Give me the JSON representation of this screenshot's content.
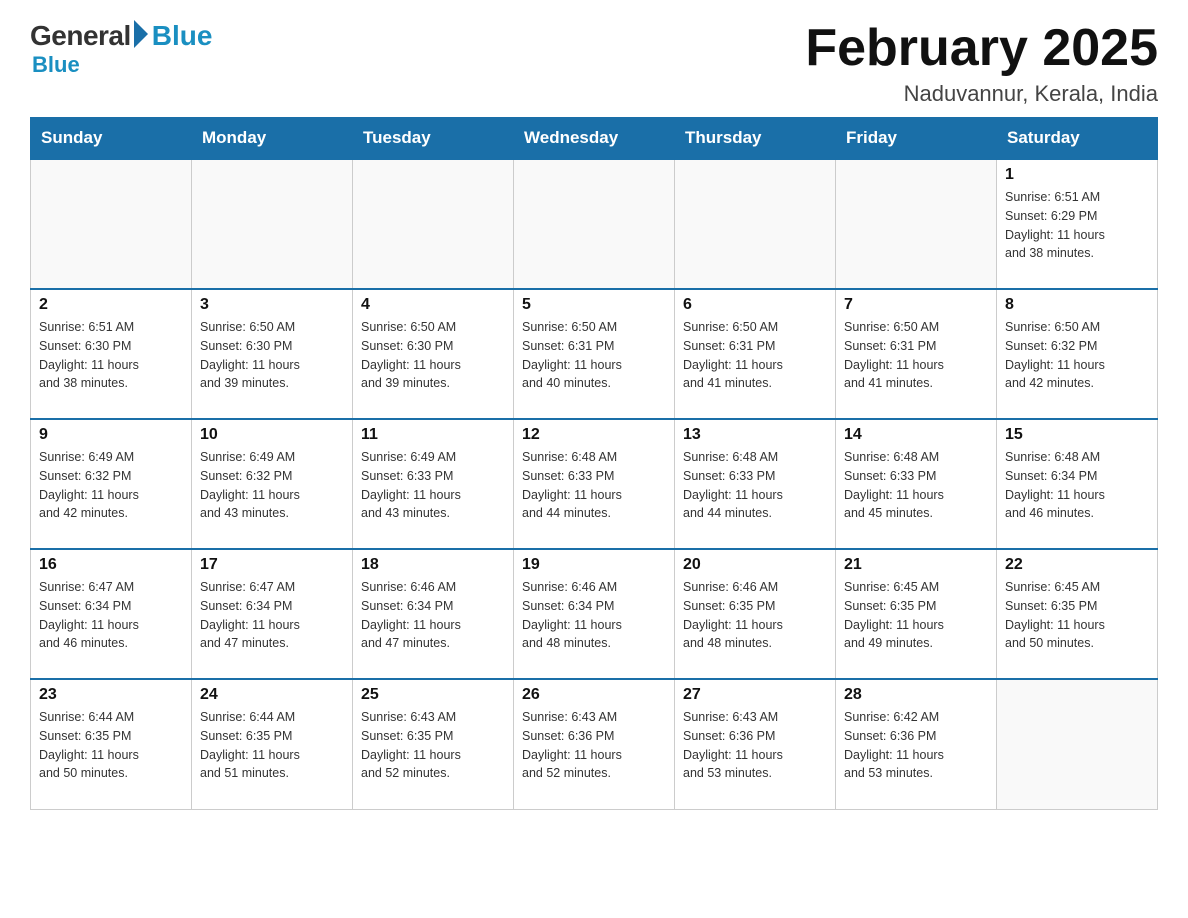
{
  "header": {
    "logo_general": "General",
    "logo_blue": "Blue",
    "month_title": "February 2025",
    "location": "Naduvannur, Kerala, India"
  },
  "days_of_week": [
    "Sunday",
    "Monday",
    "Tuesday",
    "Wednesday",
    "Thursday",
    "Friday",
    "Saturday"
  ],
  "weeks": [
    [
      {
        "day": "",
        "info": ""
      },
      {
        "day": "",
        "info": ""
      },
      {
        "day": "",
        "info": ""
      },
      {
        "day": "",
        "info": ""
      },
      {
        "day": "",
        "info": ""
      },
      {
        "day": "",
        "info": ""
      },
      {
        "day": "1",
        "info": "Sunrise: 6:51 AM\nSunset: 6:29 PM\nDaylight: 11 hours\nand 38 minutes."
      }
    ],
    [
      {
        "day": "2",
        "info": "Sunrise: 6:51 AM\nSunset: 6:30 PM\nDaylight: 11 hours\nand 38 minutes."
      },
      {
        "day": "3",
        "info": "Sunrise: 6:50 AM\nSunset: 6:30 PM\nDaylight: 11 hours\nand 39 minutes."
      },
      {
        "day": "4",
        "info": "Sunrise: 6:50 AM\nSunset: 6:30 PM\nDaylight: 11 hours\nand 39 minutes."
      },
      {
        "day": "5",
        "info": "Sunrise: 6:50 AM\nSunset: 6:31 PM\nDaylight: 11 hours\nand 40 minutes."
      },
      {
        "day": "6",
        "info": "Sunrise: 6:50 AM\nSunset: 6:31 PM\nDaylight: 11 hours\nand 41 minutes."
      },
      {
        "day": "7",
        "info": "Sunrise: 6:50 AM\nSunset: 6:31 PM\nDaylight: 11 hours\nand 41 minutes."
      },
      {
        "day": "8",
        "info": "Sunrise: 6:50 AM\nSunset: 6:32 PM\nDaylight: 11 hours\nand 42 minutes."
      }
    ],
    [
      {
        "day": "9",
        "info": "Sunrise: 6:49 AM\nSunset: 6:32 PM\nDaylight: 11 hours\nand 42 minutes."
      },
      {
        "day": "10",
        "info": "Sunrise: 6:49 AM\nSunset: 6:32 PM\nDaylight: 11 hours\nand 43 minutes."
      },
      {
        "day": "11",
        "info": "Sunrise: 6:49 AM\nSunset: 6:33 PM\nDaylight: 11 hours\nand 43 minutes."
      },
      {
        "day": "12",
        "info": "Sunrise: 6:48 AM\nSunset: 6:33 PM\nDaylight: 11 hours\nand 44 minutes."
      },
      {
        "day": "13",
        "info": "Sunrise: 6:48 AM\nSunset: 6:33 PM\nDaylight: 11 hours\nand 44 minutes."
      },
      {
        "day": "14",
        "info": "Sunrise: 6:48 AM\nSunset: 6:33 PM\nDaylight: 11 hours\nand 45 minutes."
      },
      {
        "day": "15",
        "info": "Sunrise: 6:48 AM\nSunset: 6:34 PM\nDaylight: 11 hours\nand 46 minutes."
      }
    ],
    [
      {
        "day": "16",
        "info": "Sunrise: 6:47 AM\nSunset: 6:34 PM\nDaylight: 11 hours\nand 46 minutes."
      },
      {
        "day": "17",
        "info": "Sunrise: 6:47 AM\nSunset: 6:34 PM\nDaylight: 11 hours\nand 47 minutes."
      },
      {
        "day": "18",
        "info": "Sunrise: 6:46 AM\nSunset: 6:34 PM\nDaylight: 11 hours\nand 47 minutes."
      },
      {
        "day": "19",
        "info": "Sunrise: 6:46 AM\nSunset: 6:34 PM\nDaylight: 11 hours\nand 48 minutes."
      },
      {
        "day": "20",
        "info": "Sunrise: 6:46 AM\nSunset: 6:35 PM\nDaylight: 11 hours\nand 48 minutes."
      },
      {
        "day": "21",
        "info": "Sunrise: 6:45 AM\nSunset: 6:35 PM\nDaylight: 11 hours\nand 49 minutes."
      },
      {
        "day": "22",
        "info": "Sunrise: 6:45 AM\nSunset: 6:35 PM\nDaylight: 11 hours\nand 50 minutes."
      }
    ],
    [
      {
        "day": "23",
        "info": "Sunrise: 6:44 AM\nSunset: 6:35 PM\nDaylight: 11 hours\nand 50 minutes."
      },
      {
        "day": "24",
        "info": "Sunrise: 6:44 AM\nSunset: 6:35 PM\nDaylight: 11 hours\nand 51 minutes."
      },
      {
        "day": "25",
        "info": "Sunrise: 6:43 AM\nSunset: 6:35 PM\nDaylight: 11 hours\nand 52 minutes."
      },
      {
        "day": "26",
        "info": "Sunrise: 6:43 AM\nSunset: 6:36 PM\nDaylight: 11 hours\nand 52 minutes."
      },
      {
        "day": "27",
        "info": "Sunrise: 6:43 AM\nSunset: 6:36 PM\nDaylight: 11 hours\nand 53 minutes."
      },
      {
        "day": "28",
        "info": "Sunrise: 6:42 AM\nSunset: 6:36 PM\nDaylight: 11 hours\nand 53 minutes."
      },
      {
        "day": "",
        "info": ""
      }
    ]
  ]
}
